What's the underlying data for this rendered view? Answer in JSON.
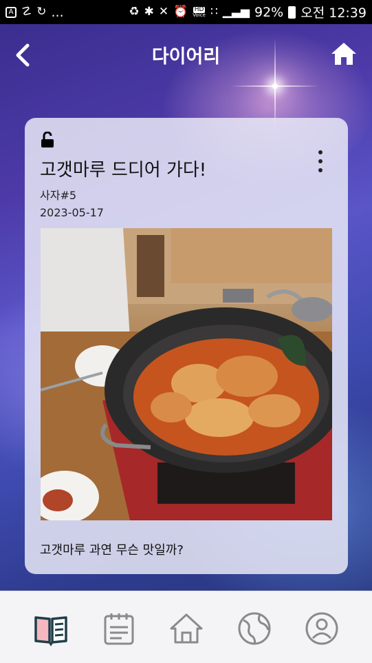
{
  "status_bar": {
    "left_icons": [
      "a-icon",
      "link-icon",
      "sync-icon"
    ],
    "left_more": "...",
    "battery": "92%",
    "time": "오전 12:39",
    "hd_label": "HD",
    "hd_sub": "Voice"
  },
  "header": {
    "title": "다이어리"
  },
  "post": {
    "title": "고갯마루 드디어 가다!",
    "author": "사자#5",
    "date": "2023-05-17",
    "caption": "고갯마루 과연 무슨 맛일까?",
    "locked": false
  },
  "bottom_nav": {
    "items": [
      "diary-icon",
      "calendar-icon",
      "home-icon",
      "globe-icon",
      "profile-icon"
    ],
    "active_index": 0
  },
  "colors": {
    "accent": "#1f3f48",
    "active_fill": "#f5b7c0",
    "inactive": "#8a8a8a"
  }
}
